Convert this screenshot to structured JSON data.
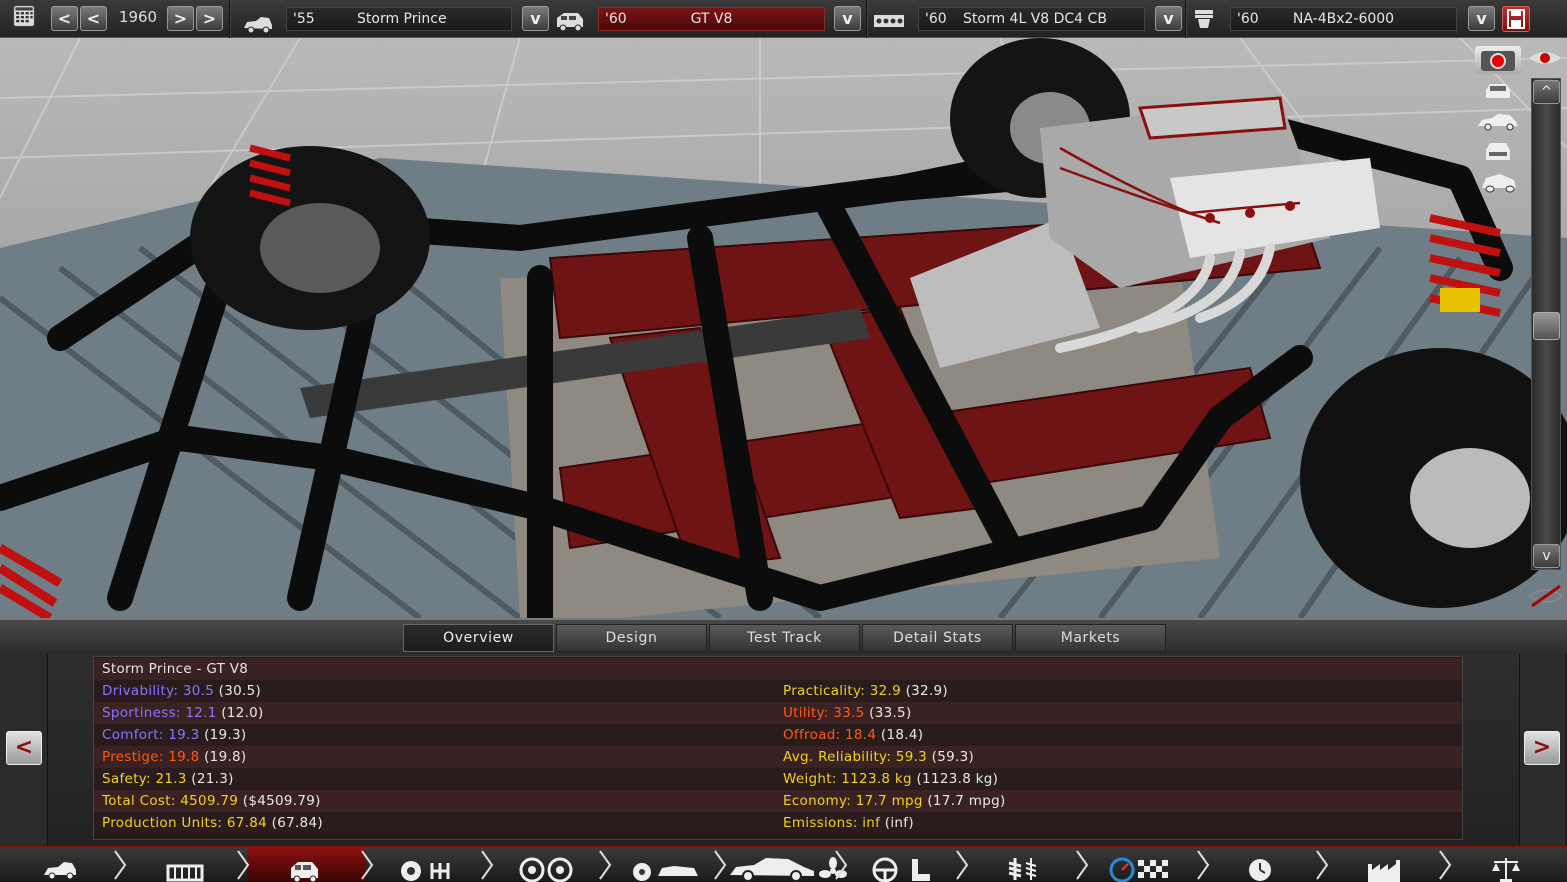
{
  "topbar": {
    "year": "1960",
    "model": {
      "year": "'55",
      "name": "Storm Prince"
    },
    "trim": {
      "year": "'60",
      "name": "GT V8"
    },
    "engine": {
      "year": "'60",
      "name": "Storm 4L V8 DC4 CB"
    },
    "engine_variant": {
      "year": "'60",
      "name": "NA-4Bx2-6000"
    },
    "dropdown_glyph": "v",
    "prev_glyph": "<",
    "next_glyph": ">"
  },
  "viewport": {
    "scroll_up": "^",
    "scroll_down": "v"
  },
  "tabs": [
    {
      "label": "Overview",
      "active": true
    },
    {
      "label": "Design",
      "active": false
    },
    {
      "label": "Test Track",
      "active": false
    },
    {
      "label": "Detail Stats",
      "active": false
    },
    {
      "label": "Markets",
      "active": false
    }
  ],
  "stats": {
    "title": "Storm Prince - GT V8",
    "left": [
      {
        "label": "Drivability: 30.5",
        "paren": "(30.5)",
        "color": "#8a73ff"
      },
      {
        "label": "Sportiness: 12.1",
        "paren": "(12.0)",
        "color": "#8a73ff"
      },
      {
        "label": "Comfort: 19.3",
        "paren": "(19.3)",
        "color": "#8a73ff"
      },
      {
        "label": "Prestige: 19.8",
        "paren": "(19.8)",
        "color": "#ff5a10"
      },
      {
        "label": "Safety: 21.3",
        "paren": "(21.3)",
        "color": "#f2d21e"
      },
      {
        "label": "Total Cost: 4509.79",
        "paren": "($4509.79)",
        "color": "#f2d21e"
      },
      {
        "label": "Production Units: 67.84",
        "paren": "(67.84)",
        "color": "#f2d21e"
      }
    ],
    "right": [
      {
        "label": "Practicality: 32.9",
        "paren": "(32.9)",
        "color": "#f2d21e"
      },
      {
        "label": "Utility: 33.5",
        "paren": "(33.5)",
        "color": "#ff5a10"
      },
      {
        "label": "Offroad: 18.4",
        "paren": "(18.4)",
        "color": "#ff5a10"
      },
      {
        "label": "Avg. Reliability: 59.3",
        "paren": "(59.3)",
        "color": "#f2d21e"
      },
      {
        "label": "Weight: 1123.8 kg",
        "paren": "(1123.8 kg)",
        "color": "#f2d21e"
      },
      {
        "label": "Economy: 17.7 mpg",
        "paren": "(17.7 mpg)",
        "color": "#f2d21e"
      },
      {
        "label": "Emissions: inf",
        "paren": "(inf)",
        "color": "#f2d21e"
      }
    ],
    "prev_glyph": "<",
    "next_glyph": ">"
  },
  "nav": {
    "icons": [
      "car-model-icon",
      "chassis-icon",
      "car-trim-icon",
      "engine-gearbox-icon",
      "wheels-icon",
      "body-design-icon",
      "fan-icon",
      "interior-icon",
      "suspension-icon",
      "test-track-icon",
      "timer-icon",
      "factory-icon",
      "markets-scale-icon"
    ],
    "active": "car-trim-icon"
  },
  "colors": {
    "accent_red": "#8a1010",
    "panel_row": "#3a2222"
  }
}
